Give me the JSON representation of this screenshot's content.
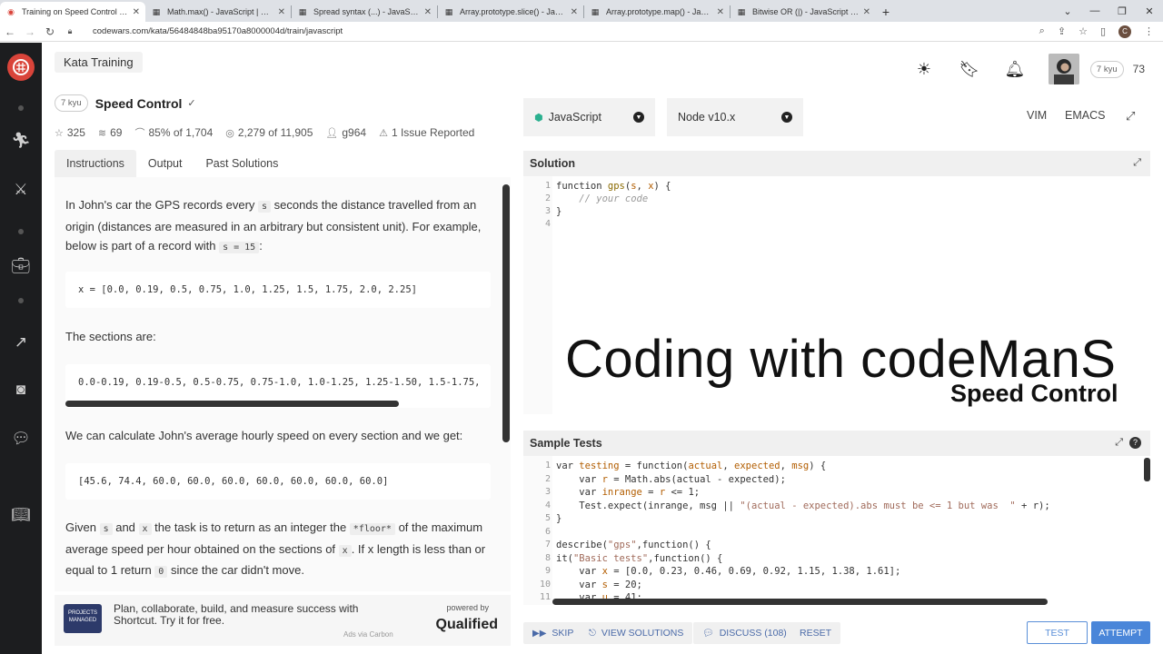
{
  "browser": {
    "tabs": [
      {
        "title": "Training on Speed Control | Codewars",
        "active": true
      },
      {
        "title": "Math.max() - JavaScript | MDN"
      },
      {
        "title": "Spread syntax (...) - JavaScript | MDN"
      },
      {
        "title": "Array.prototype.slice() - JavaScript | MDN"
      },
      {
        "title": "Array.prototype.map() - JavaScript | MDN"
      },
      {
        "title": "Bitwise OR (|) - JavaScript | MDN"
      }
    ],
    "new_tab": "+",
    "url": "codewars.com/kata/56484848ba95170a8000004d/train/javascript",
    "profile_initial": "C"
  },
  "header": {
    "section": "Kata Training",
    "rank": "7 kyu",
    "honor": "73"
  },
  "kata": {
    "rank": "7 kyu",
    "title": "Speed Control",
    "stats": {
      "stars": "325",
      "collections": "69",
      "satisfaction_pct": "85%",
      "of1": "of",
      "satisfaction_votes": "1,704",
      "completed": "2,279",
      "of2": "of",
      "attempts": "11,905",
      "author": "g964",
      "issues": "1 Issue Reported"
    }
  },
  "left_tabs": [
    "Instructions",
    "Output",
    "Past Solutions"
  ],
  "instructions": {
    "p1_a": "In John's car the GPS records every ",
    "p1_code1": "s",
    "p1_b": " seconds the distance travelled from an origin (distances are measured in an arbitrary but consistent unit). For example, below is part of a record with ",
    "p1_code2": "s = 15",
    "p1_c": ":",
    "code1": "x = [0.0, 0.19, 0.5, 0.75, 1.0, 1.25, 1.5, 1.75, 2.0, 2.25]",
    "p2": "The sections are:",
    "code2": "0.0-0.19, 0.19-0.5, 0.5-0.75, 0.75-1.0, 1.0-1.25, 1.25-1.50, 1.5-1.75,",
    "p3": "We can calculate John's average hourly speed on every section and we get:",
    "code3": "[45.6, 74.4, 60.0, 60.0, 60.0, 60.0, 60.0, 60.0, 60.0]",
    "p4_a": "Given ",
    "p4_s": "s",
    "p4_and": " and ",
    "p4_x": "x",
    "p4_b": " the task is to return as an integer the ",
    "p4_floor": "*floor*",
    "p4_c": " of the maximum average speed per hour obtained on the sections of ",
    "p4_x2": "x",
    "p4_d": ". If x length is less than or equal to 1 return ",
    "p4_zero": "0",
    "p4_e": " since the car didn't move."
  },
  "ad": {
    "image_text": "PROJECTS MANAGED",
    "text": "Plan, collaborate, build, and measure success with Shortcut. Try it for free.",
    "powered_by": "powered by",
    "brand": "Qualified",
    "via": "Ads via Carbon"
  },
  "editor": {
    "language": "JavaScript",
    "runtime": "Node v10.x",
    "modes": [
      "VIM",
      "EMACS"
    ]
  },
  "solution": {
    "title": "Solution",
    "lines": [
      "1",
      "2",
      "3",
      "4"
    ]
  },
  "watermark": {
    "line1": "Coding with codeManS",
    "line2": "Speed Control"
  },
  "sample_tests": {
    "title": "Sample Tests",
    "lines": [
      "1",
      "2",
      "3",
      "4",
      "5",
      "6",
      "7",
      "8",
      "9",
      "10",
      "11"
    ]
  },
  "buttons": {
    "skip": "SKIP",
    "view_solutions": "VIEW SOLUTIONS",
    "discuss": "DISCUSS (108)",
    "reset": "RESET",
    "test": "TEST",
    "attempt": "ATTEMPT"
  }
}
